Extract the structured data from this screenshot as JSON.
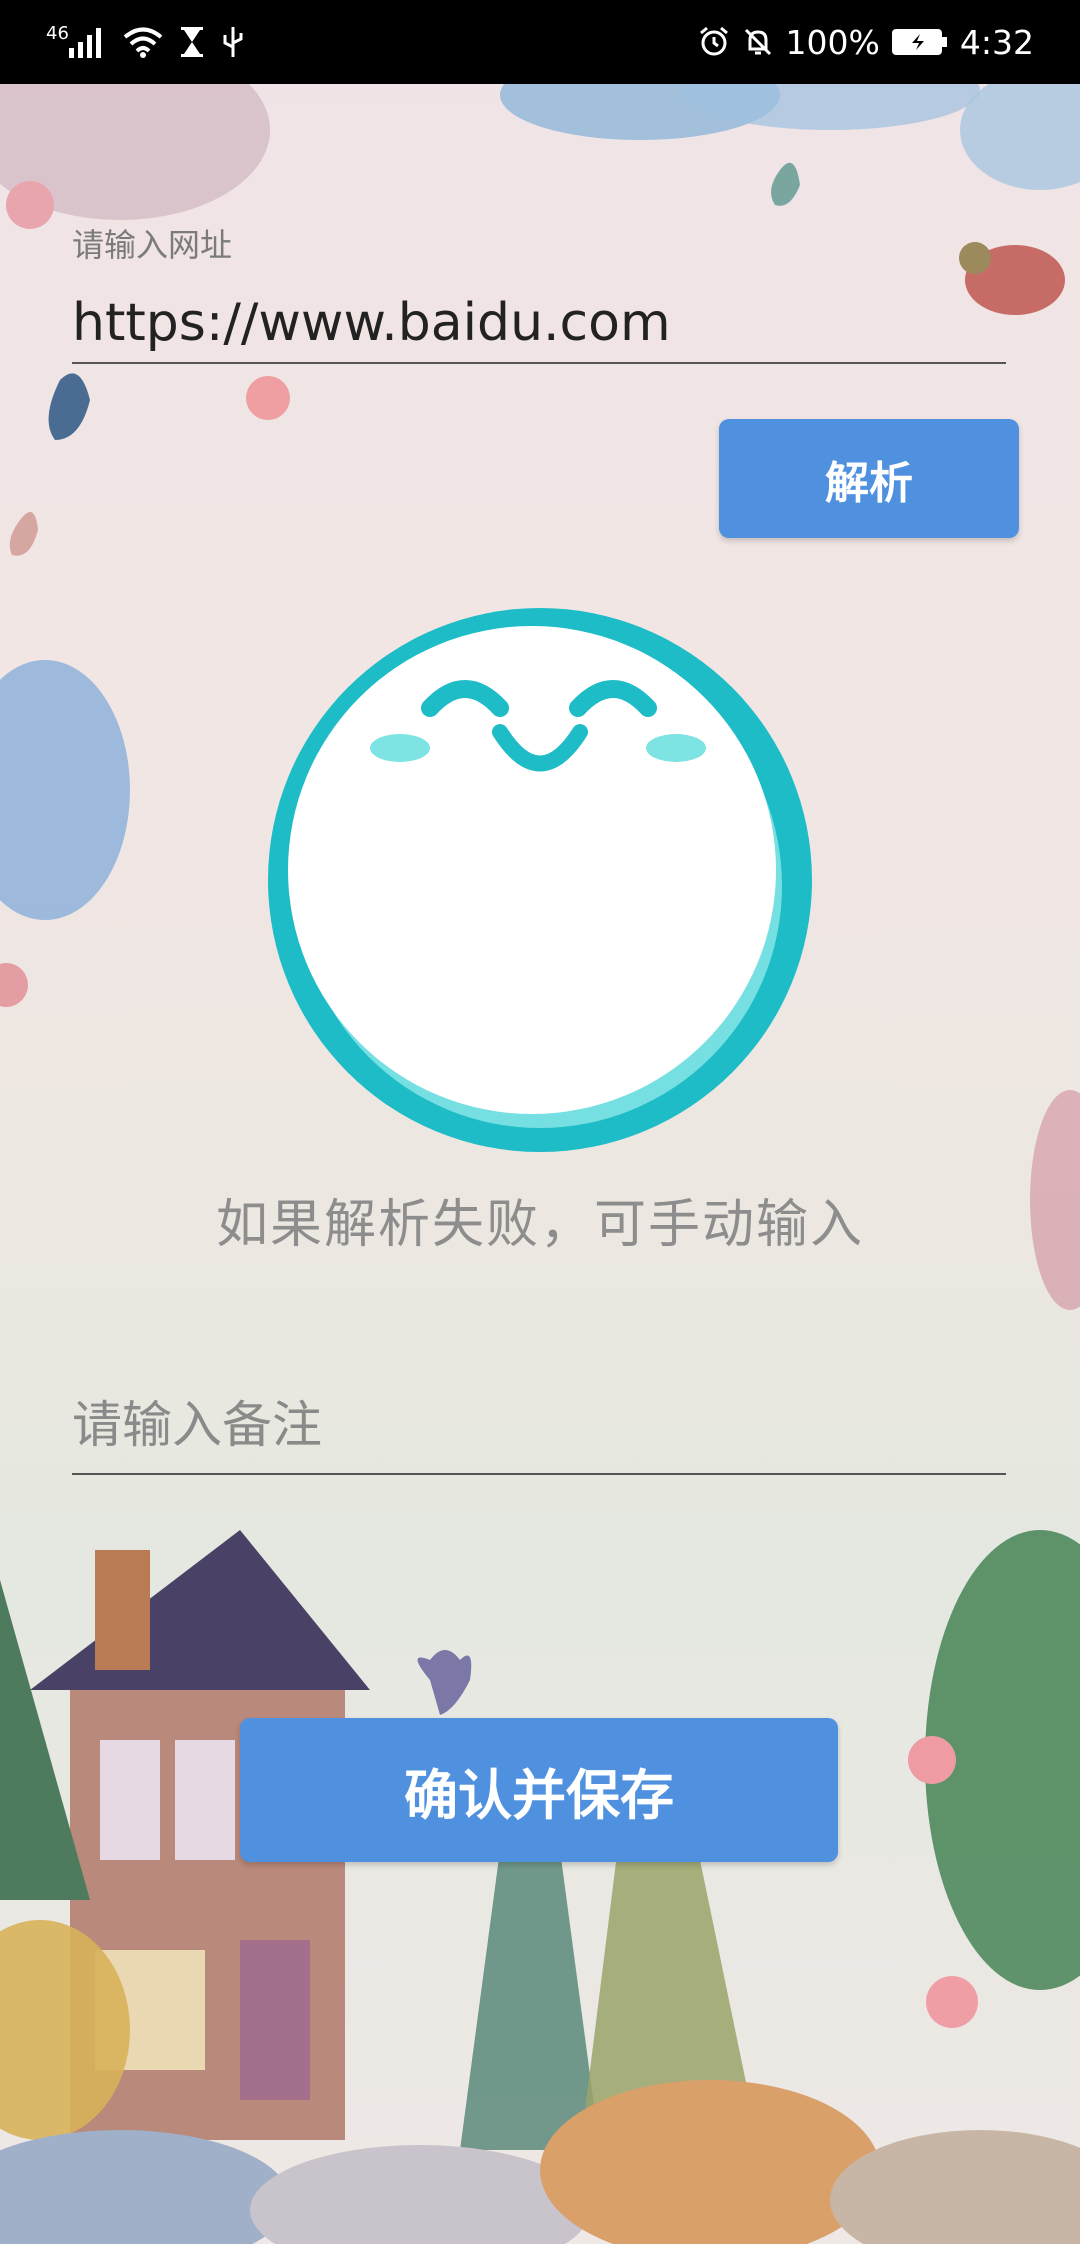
{
  "status_bar": {
    "network": "46",
    "battery": "100%",
    "time": "4:32",
    "icons": [
      "signal-icon",
      "wifi-icon",
      "hourglass-icon",
      "usb-icon",
      "alarm-icon",
      "mute-bell-icon",
      "battery-icon"
    ]
  },
  "url_section": {
    "label": "请输入网址",
    "value": "https://www.baidu.com"
  },
  "parse_button": {
    "label": "解析"
  },
  "hint": {
    "text": "如果解析失败，可手动输入"
  },
  "remark": {
    "placeholder": "请输入备注"
  },
  "save_button": {
    "label": "确认并保存"
  },
  "colors": {
    "button": "#4f91df",
    "mascot_ring": "#1dbcc6",
    "mascot_blush": "#7de3e3",
    "status_bar": "#000000"
  }
}
